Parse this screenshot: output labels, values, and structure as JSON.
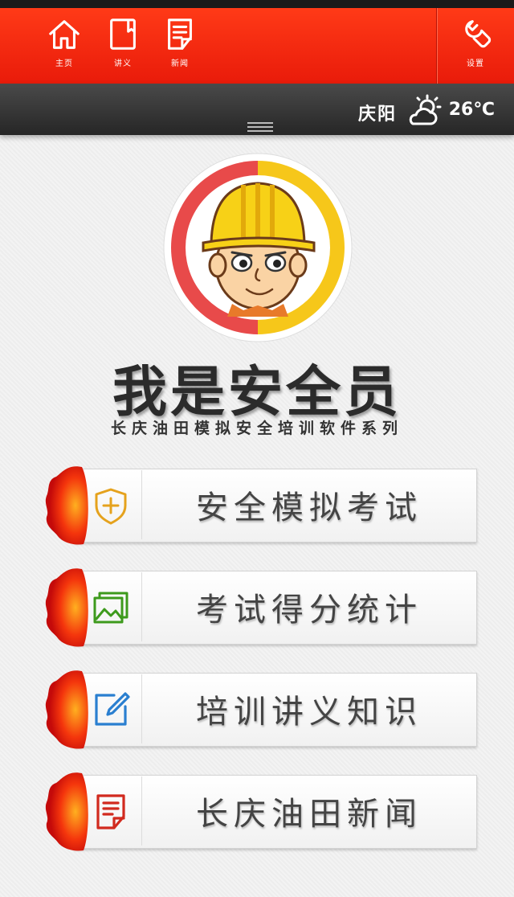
{
  "nav": {
    "home_label": "主页",
    "lecture_label": "讲义",
    "news_label": "新闻",
    "settings_label": "设置"
  },
  "weather": {
    "city": "庆阳",
    "temperature": "26℃",
    "icon": "cloudy-sun-icon"
  },
  "app": {
    "title": "我是安全员",
    "subtitle": "长庆油田模拟安全培训软件系列"
  },
  "menu": [
    {
      "label": "安全模拟考试",
      "icon": "shield-plus-icon",
      "icon_color": "#e5a21d"
    },
    {
      "label": "考试得分统计",
      "icon": "images-icon",
      "icon_color": "#3d9a1c"
    },
    {
      "label": "培训讲义知识",
      "icon": "edit-icon",
      "icon_color": "#2a7fd0"
    },
    {
      "label": "长庆油田新闻",
      "icon": "document-icon",
      "icon_color": "#d12a1e"
    }
  ],
  "colors": {
    "topbar": "#f02a10",
    "accent_red": "#e83a3a",
    "accent_yellow": "#f6c71a"
  }
}
